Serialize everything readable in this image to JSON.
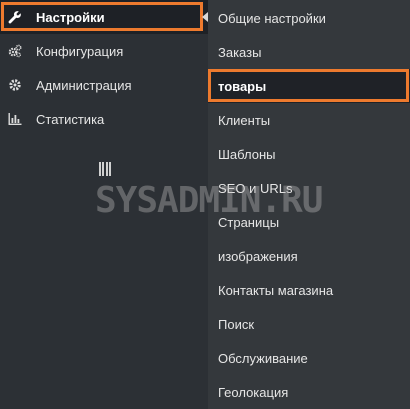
{
  "menu": {
    "items": [
      {
        "label": "Настройки",
        "icon": "wrench-icon",
        "active": true
      },
      {
        "label": "Конфигурация",
        "icon": "gears-icon",
        "active": false
      },
      {
        "label": "Администрация",
        "icon": "gear-icon",
        "active": false
      },
      {
        "label": "Статистика",
        "icon": "bar-chart-icon",
        "active": false
      }
    ]
  },
  "submenu": {
    "items": [
      {
        "label": "Общие настройки"
      },
      {
        "label": "Заказы"
      },
      {
        "label": "товары",
        "highlighted": true
      },
      {
        "label": "Клиенты"
      },
      {
        "label": "Шаблоны"
      },
      {
        "label": "SEO и URLs"
      },
      {
        "label": "Страницы"
      },
      {
        "label": "изображения"
      },
      {
        "label": "Контакты магазина"
      },
      {
        "label": "Поиск"
      },
      {
        "label": "Обслуживание"
      },
      {
        "label": "Геолокация"
      }
    ]
  },
  "watermark": {
    "text": "SYSADMIN.RU"
  },
  "colors": {
    "accent_frame": "#ed7a2e",
    "left_bg": "#2c3035",
    "submenu_bg": "#34383c",
    "active_bg": "#1e2126",
    "text": "#e6e6e6"
  }
}
